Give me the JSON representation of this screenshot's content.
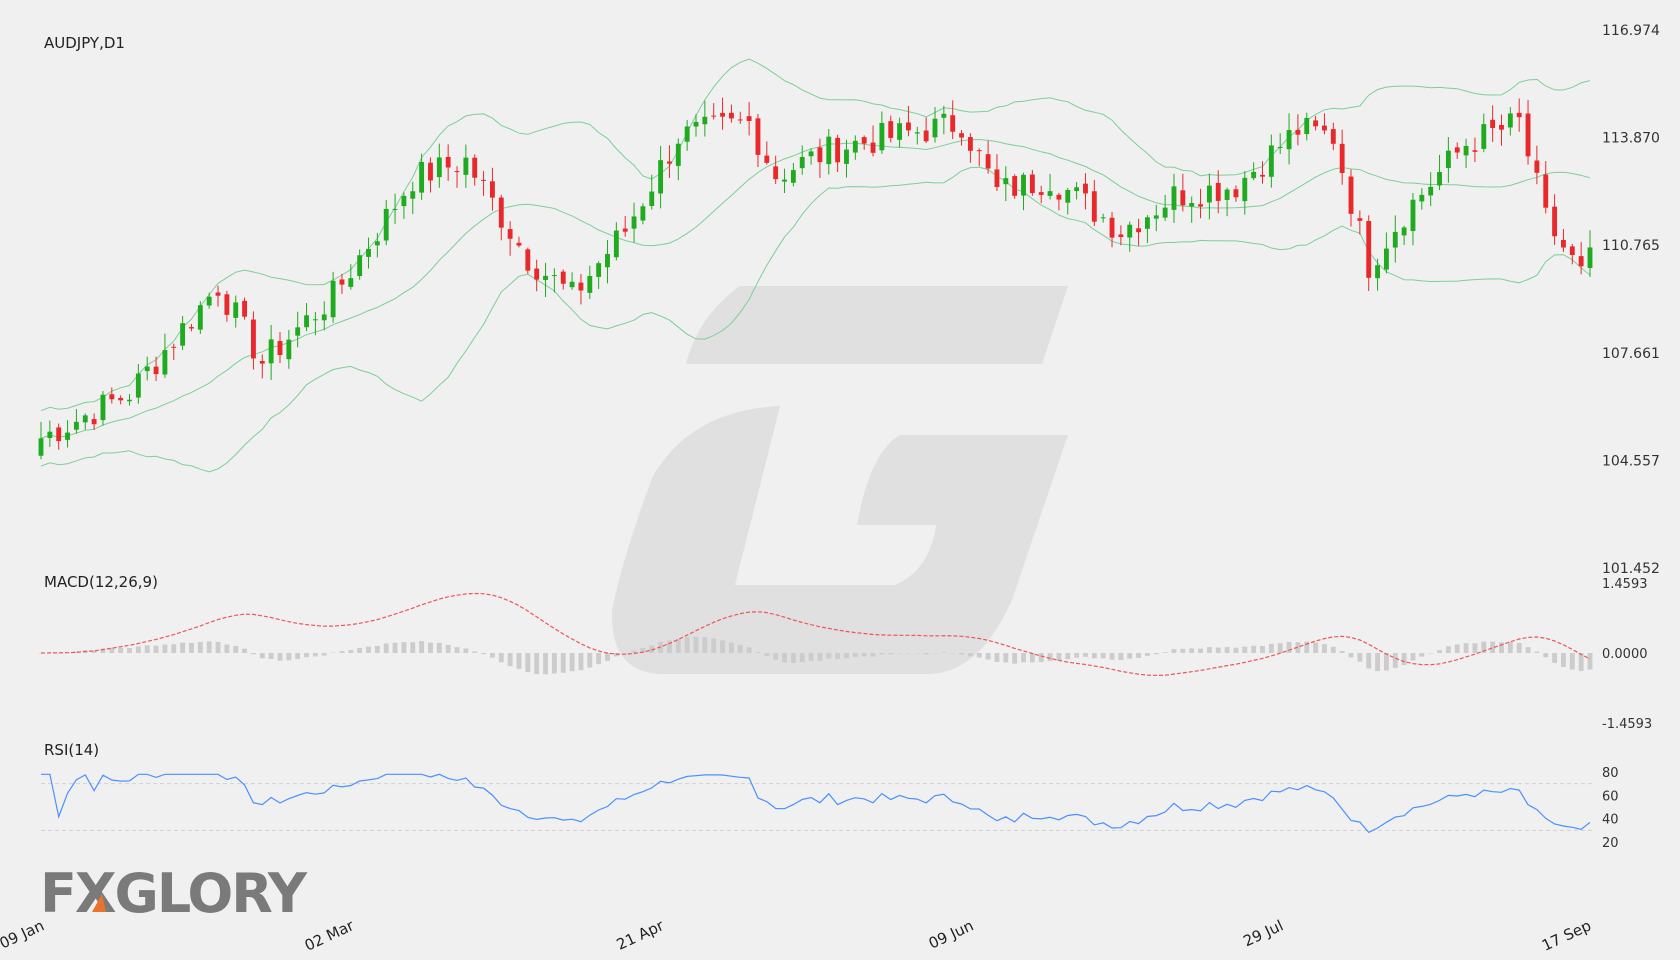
{
  "chart_data": [
    {
      "type": "candlestick",
      "title": "AUDJPY,D1",
      "symbol": "AUDJPY",
      "timeframe": "D1",
      "y_ticks": [
        "116.974",
        "113.870",
        "110.765",
        "107.661",
        "104.557",
        "101.452"
      ],
      "ylim": [
        101.452,
        116.974
      ],
      "x_tick_labels": [
        "09 Jan",
        "02 Mar",
        "21 Apr",
        "09 Jun",
        "29 Jul",
        "17 Sep"
      ],
      "bars_count": 176,
      "overlays": [
        "Bollinger Bands"
      ],
      "colors": {
        "up": "#1faa1f",
        "down": "#e8282b",
        "bands": "#7ccf97"
      },
      "trend_keypoints": [
        {
          "bar": 0,
          "close": 105.2
        },
        {
          "bar": 10,
          "close": 106.5
        },
        {
          "bar": 20,
          "close": 109.6
        },
        {
          "bar": 25,
          "close": 107.4
        },
        {
          "bar": 33,
          "close": 109.3
        },
        {
          "bar": 42,
          "close": 112.7
        },
        {
          "bar": 48,
          "close": 113.2
        },
        {
          "bar": 55,
          "close": 110.4
        },
        {
          "bar": 60,
          "close": 109.3
        },
        {
          "bar": 66,
          "close": 111.2
        },
        {
          "bar": 72,
          "close": 113.9
        },
        {
          "bar": 80,
          "close": 114.3
        },
        {
          "bar": 83,
          "close": 112.8
        },
        {
          "bar": 90,
          "close": 113.6
        },
        {
          "bar": 104,
          "close": 114.3
        },
        {
          "bar": 108,
          "close": 112.3
        },
        {
          "bar": 114,
          "close": 112.7
        },
        {
          "bar": 122,
          "close": 111.2
        },
        {
          "bar": 128,
          "close": 112.2
        },
        {
          "bar": 135,
          "close": 112.5
        },
        {
          "bar": 142,
          "close": 114.1
        },
        {
          "bar": 146,
          "close": 113.9
        },
        {
          "bar": 150,
          "close": 110.2
        },
        {
          "bar": 154,
          "close": 111.7
        },
        {
          "bar": 161,
          "close": 113.7
        },
        {
          "bar": 167,
          "close": 114.3
        },
        {
          "bar": 170,
          "close": 111.5
        },
        {
          "bar": 174,
          "close": 109.9
        },
        {
          "bar": 175,
          "close": 110.7
        }
      ]
    },
    {
      "type": "bar+line",
      "title": "MACD(12,26,9)",
      "y_ticks": [
        "1.4593",
        "0.0000",
        "-1.4593"
      ],
      "ylim": [
        -1.4593,
        1.4593
      ],
      "series": [
        {
          "name": "MACD",
          "kind": "histogram",
          "color": "#cccccc"
        },
        {
          "name": "Signal",
          "kind": "dashed-line",
          "color": "#f05555"
        }
      ]
    },
    {
      "type": "line",
      "title": "RSI(14)",
      "y_ticks": [
        "80",
        "60",
        "40",
        "20"
      ],
      "ylim": [
        20,
        80
      ],
      "levels": [
        70,
        30
      ],
      "series": [
        {
          "name": "RSI",
          "color": "#4a90ff"
        }
      ]
    }
  ],
  "watermark": {
    "brand_text": "FXGLORY",
    "accent_color": "#e8732a"
  }
}
